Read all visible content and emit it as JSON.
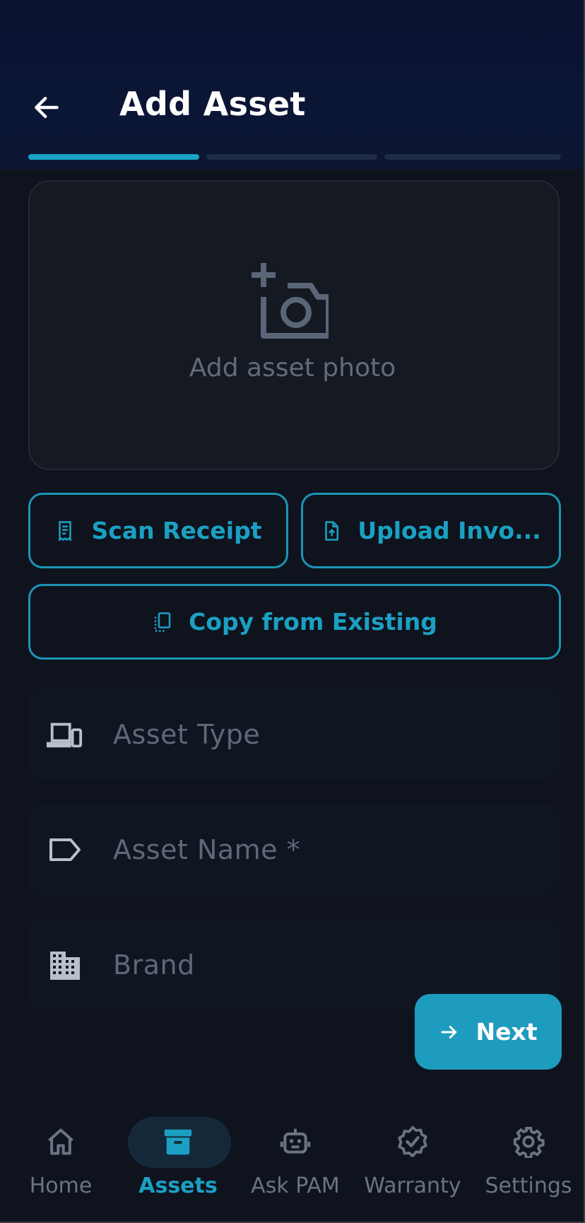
{
  "header": {
    "title": "Add Asset",
    "steps_total": 3,
    "current_step": 1
  },
  "photo": {
    "label": "Add asset photo",
    "icon": "add-photo-icon"
  },
  "actions": {
    "scan_receipt": "Scan Receipt",
    "upload_invoice": "Upload Invo...",
    "copy_existing": "Copy from Existing"
  },
  "form": {
    "asset_type_placeholder": "Asset Type",
    "asset_name_placeholder": "Asset Name *",
    "brand_placeholder": "Brand"
  },
  "next_label": "Next",
  "nav": {
    "items": [
      {
        "label": "Home",
        "icon": "home-icon"
      },
      {
        "label": "Assets",
        "icon": "archive-icon",
        "active": true
      },
      {
        "label": "Ask PAM",
        "icon": "robot-icon"
      },
      {
        "label": "Warranty",
        "icon": "verified-badge-icon"
      },
      {
        "label": "Settings",
        "icon": "gear-icon"
      }
    ]
  },
  "colors": {
    "accent": "#1ba0c2",
    "background": "#0e131d",
    "header": "#0b1535"
  }
}
